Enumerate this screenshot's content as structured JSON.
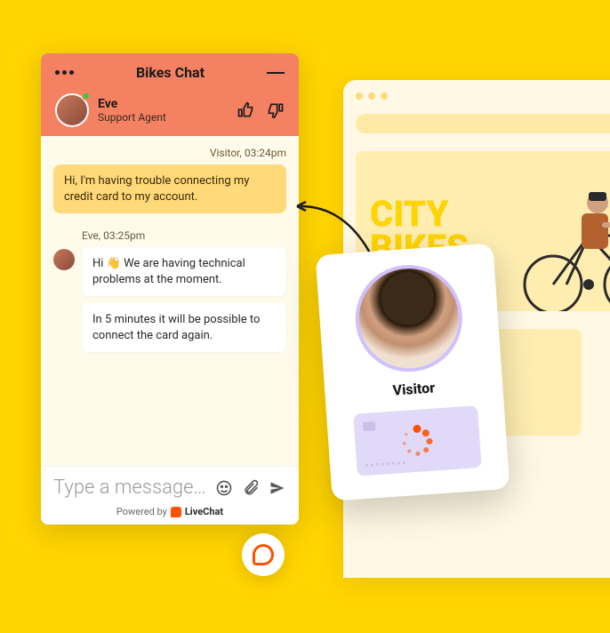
{
  "chat": {
    "title": "Bikes Chat",
    "agent": {
      "name": "Eve",
      "role": "Support Agent"
    },
    "messages": {
      "visitor_meta": "Visitor, 03:24pm",
      "visitor_text": "Hi, I'm having trouble connecting my credit card to my account.",
      "agent_meta": "Eve, 03:25pm",
      "agent_text_1": "Hi 👋 We are having technical problems at the moment.",
      "agent_text_2": "In 5 minutes it will be possible to connect the card again."
    },
    "input": {
      "placeholder": "Type a message…"
    },
    "footer": {
      "powered_by": "Powered by",
      "brand": "LiveChat"
    }
  },
  "browser": {
    "hero_line1": "CITY",
    "hero_line2": "BIKES"
  },
  "visitor_card": {
    "label": "Visitor"
  }
}
